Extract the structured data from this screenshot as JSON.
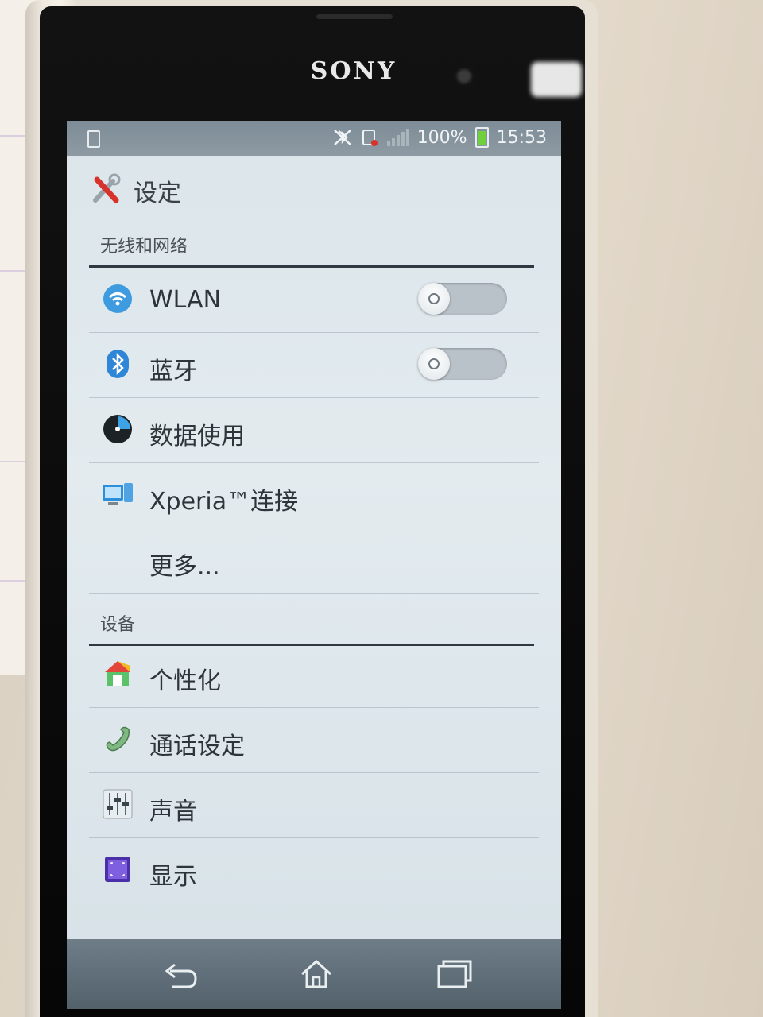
{
  "device": {
    "brand": "SONY"
  },
  "status_bar": {
    "battery": "100%",
    "time": "15:53",
    "colors": {
      "battery_fill": "#6fcf3c"
    }
  },
  "action_bar": {
    "title": "设定",
    "icon": "settings-tools-icon"
  },
  "sections": {
    "wireless": {
      "label": "无线和网络",
      "items": [
        {
          "label": "WLAN",
          "icon": "wifi-icon",
          "toggle": "off"
        },
        {
          "label": "蓝牙",
          "icon": "bluetooth-icon",
          "toggle": "off"
        },
        {
          "label": "数据使用",
          "icon": "data-usage-icon"
        },
        {
          "label": "Xperia™连接",
          "icon": "xperia-connect-icon"
        },
        {
          "label": "更多..."
        }
      ]
    },
    "device": {
      "label": "设备",
      "items": [
        {
          "label": "个性化",
          "icon": "personalization-icon"
        },
        {
          "label": "通话设定",
          "icon": "phone-handset-icon"
        },
        {
          "label": "声音",
          "icon": "sliders-icon"
        },
        {
          "label": "显示",
          "icon": "display-icon"
        }
      ]
    }
  },
  "nav_bar": {
    "buttons": [
      "back-icon",
      "home-icon",
      "recent-apps-icon"
    ]
  }
}
